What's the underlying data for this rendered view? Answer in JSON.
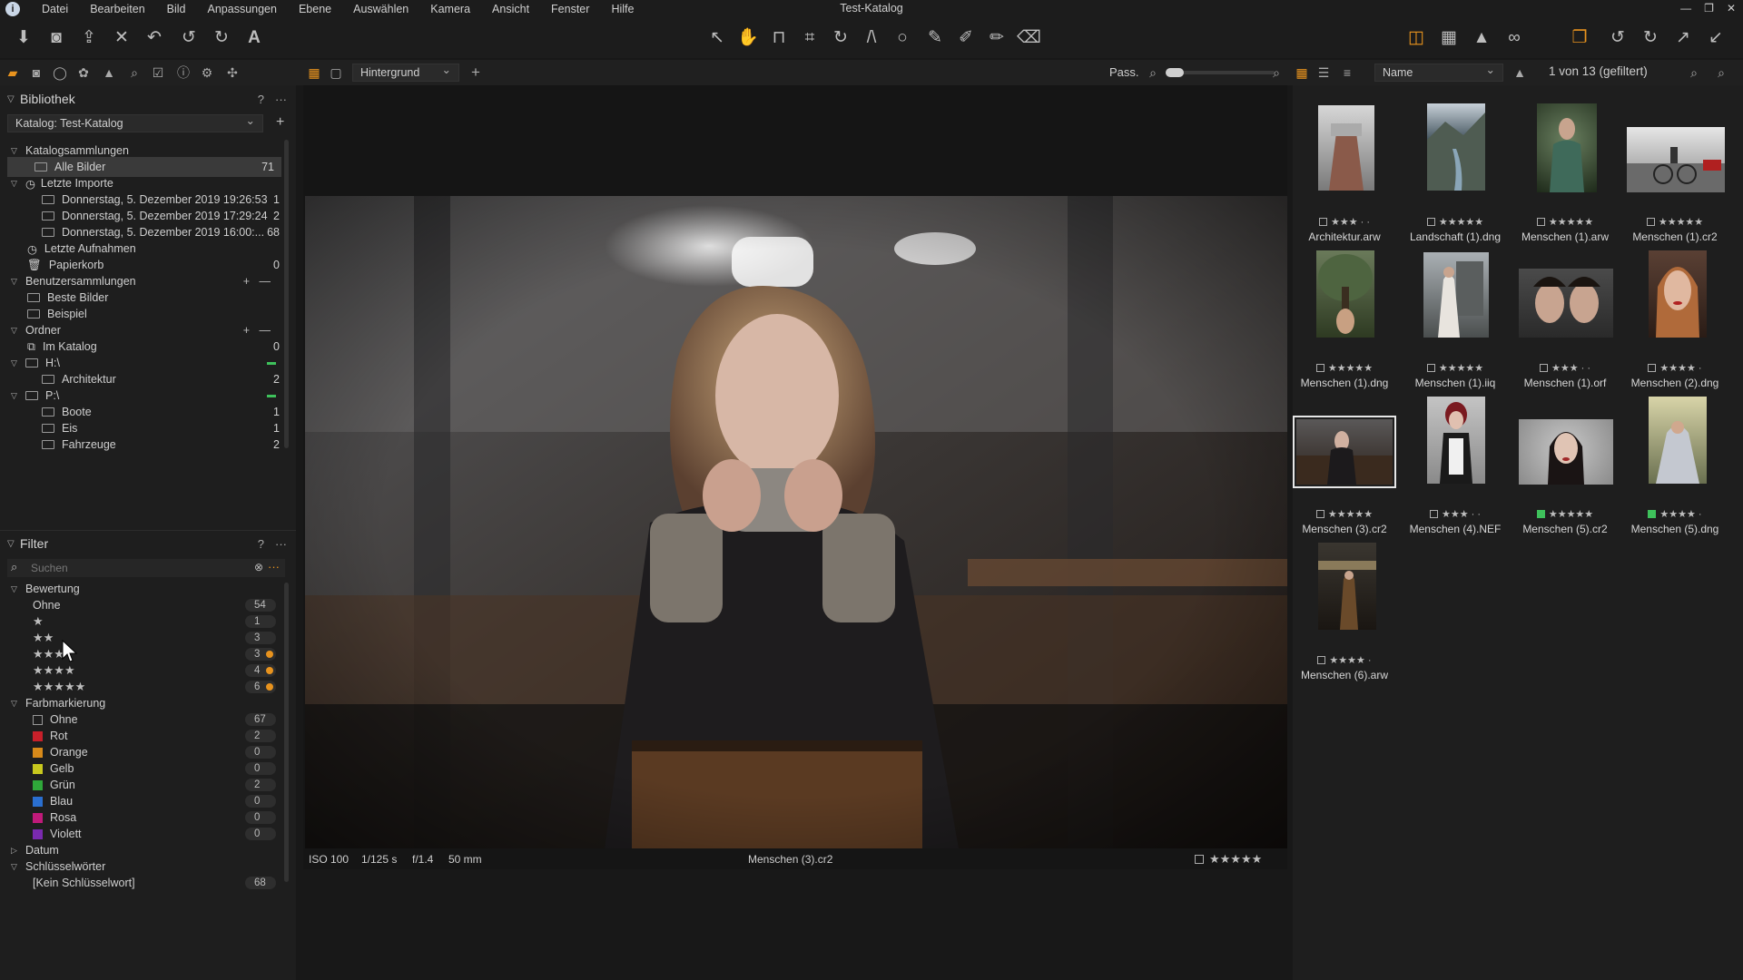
{
  "menu": {
    "items": [
      "Datei",
      "Bearbeiten",
      "Bild",
      "Anpassungen",
      "Ebene",
      "Auswählen",
      "Kamera",
      "Ansicht",
      "Fenster",
      "Hilfe"
    ],
    "window_title": "Test-Katalog"
  },
  "toolbar_icons": [
    "import-icon",
    "camera-icon",
    "export-icon",
    "delete-icon",
    "undo-icon",
    "undo-alt-icon",
    "redo-icon",
    "text-icon"
  ],
  "viewer_toolbar": {
    "layer_select": "Hintergrund",
    "zoom_label": "Pass."
  },
  "browser_toolbar": {
    "sort_select": "Name",
    "count_label": "1 von 13 (gefiltert)"
  },
  "library": {
    "title": "Bibliothek",
    "catalog_select": "Katalog: Test-Katalog",
    "sections": {
      "catalog_collections": "Katalogsammlungen",
      "user_collections": "Benutzersammlungen",
      "folders": "Ordner"
    },
    "items": [
      {
        "label": "Alle Bilder",
        "count": "71"
      },
      {
        "label": "Letzte Importe",
        "count": ""
      },
      {
        "label": "Donnerstag, 5. Dezember 2019 19:26:53",
        "count": "1"
      },
      {
        "label": "Donnerstag, 5. Dezember 2019 17:29:24",
        "count": "2"
      },
      {
        "label": "Donnerstag, 5. Dezember 2019 16:00:...",
        "count": "68"
      },
      {
        "label": "Letzte Aufnahmen",
        "count": ""
      },
      {
        "label": "Papierkorb",
        "count": "0"
      },
      {
        "label": "Beste Bilder",
        "count": ""
      },
      {
        "label": "Beispiel",
        "count": ""
      },
      {
        "label": "Im Katalog",
        "count": "0"
      },
      {
        "label": "H:\\",
        "count": ""
      },
      {
        "label": "Architektur",
        "count": "2"
      },
      {
        "label": "P:\\",
        "count": ""
      },
      {
        "label": "Boote",
        "count": "1"
      },
      {
        "label": "Eis",
        "count": "1"
      },
      {
        "label": "Fahrzeuge",
        "count": "2"
      }
    ]
  },
  "filter": {
    "title": "Filter",
    "search_placeholder": "Suchen",
    "rating_title": "Bewertung",
    "ratings": [
      {
        "label": "Ohne",
        "count": "54",
        "dot": ""
      },
      {
        "label": "★",
        "count": "1",
        "dot": ""
      },
      {
        "label": "★★",
        "count": "3",
        "dot": ""
      },
      {
        "label": "★★★",
        "count": "3",
        "dot": "#e8931e"
      },
      {
        "label": "★★★★",
        "count": "4",
        "dot": "#e8931e"
      },
      {
        "label": "★★★★★",
        "count": "6",
        "dot": "#e8931e"
      }
    ],
    "color_title": "Farbmarkierung",
    "colors": [
      {
        "label": "Ohne",
        "count": "67",
        "color": "none"
      },
      {
        "label": "Rot",
        "count": "2",
        "color": "#c8202a"
      },
      {
        "label": "Orange",
        "count": "0",
        "color": "#d88a1a"
      },
      {
        "label": "Gelb",
        "count": "0",
        "color": "#c8c81e"
      },
      {
        "label": "Grün",
        "count": "2",
        "color": "#2fa83a"
      },
      {
        "label": "Blau",
        "count": "0",
        "color": "#2a6fd0"
      },
      {
        "label": "Rosa",
        "count": "0",
        "color": "#c01a7a"
      },
      {
        "label": "Violett",
        "count": "0",
        "color": "#7a2ab0"
      }
    ],
    "date_title": "Datum",
    "keywords_title": "Schlüsselwörter",
    "keywords": [
      {
        "label": "[Kein Schlüsselwort]",
        "count": "68"
      }
    ]
  },
  "viewer": {
    "iso": "ISO 100",
    "shutter": "1/125 s",
    "aperture": "f/1.4",
    "focal": "50 mm",
    "filename": "Menschen (3).cr2",
    "rating_stars": "★★★★★"
  },
  "thumbnails": [
    {
      "name": "Architektur.arw",
      "stars": "★★★ · ·",
      "label": "",
      "selected": false
    },
    {
      "name": "Landschaft (1).dng",
      "stars": "★★★★★",
      "label": "",
      "selected": false
    },
    {
      "name": "Menschen (1).arw",
      "stars": "★★★★★",
      "label": "",
      "selected": false
    },
    {
      "name": "Menschen (1).cr2",
      "stars": "★★★★★",
      "label": "",
      "selected": false
    },
    {
      "name": "Menschen (1).dng",
      "stars": "★★★★★",
      "label": "",
      "selected": false
    },
    {
      "name": "Menschen (1).iiq",
      "stars": "★★★★★",
      "label": "",
      "selected": false
    },
    {
      "name": "Menschen (1).orf",
      "stars": "★★★ · ·",
      "label": "",
      "selected": false
    },
    {
      "name": "Menschen (2).dng",
      "stars": "★★★★ ·",
      "label": "",
      "selected": false
    },
    {
      "name": "Menschen (3).cr2",
      "stars": "★★★★★",
      "label": "",
      "selected": true
    },
    {
      "name": "Menschen (4).NEF",
      "stars": "★★★ · ·",
      "label": "",
      "selected": false
    },
    {
      "name": "Menschen (5).cr2",
      "stars": "★★★★★",
      "label": "green",
      "selected": false
    },
    {
      "name": "Menschen (5).dng",
      "stars": "★★★★ ·",
      "label": "green",
      "selected": false
    },
    {
      "name": "Menschen (6).arw",
      "stars": "★★★★ ·",
      "label": "",
      "selected": false
    }
  ],
  "colors": {
    "accent": "#e8931e",
    "label_green": "#3ec15b"
  }
}
